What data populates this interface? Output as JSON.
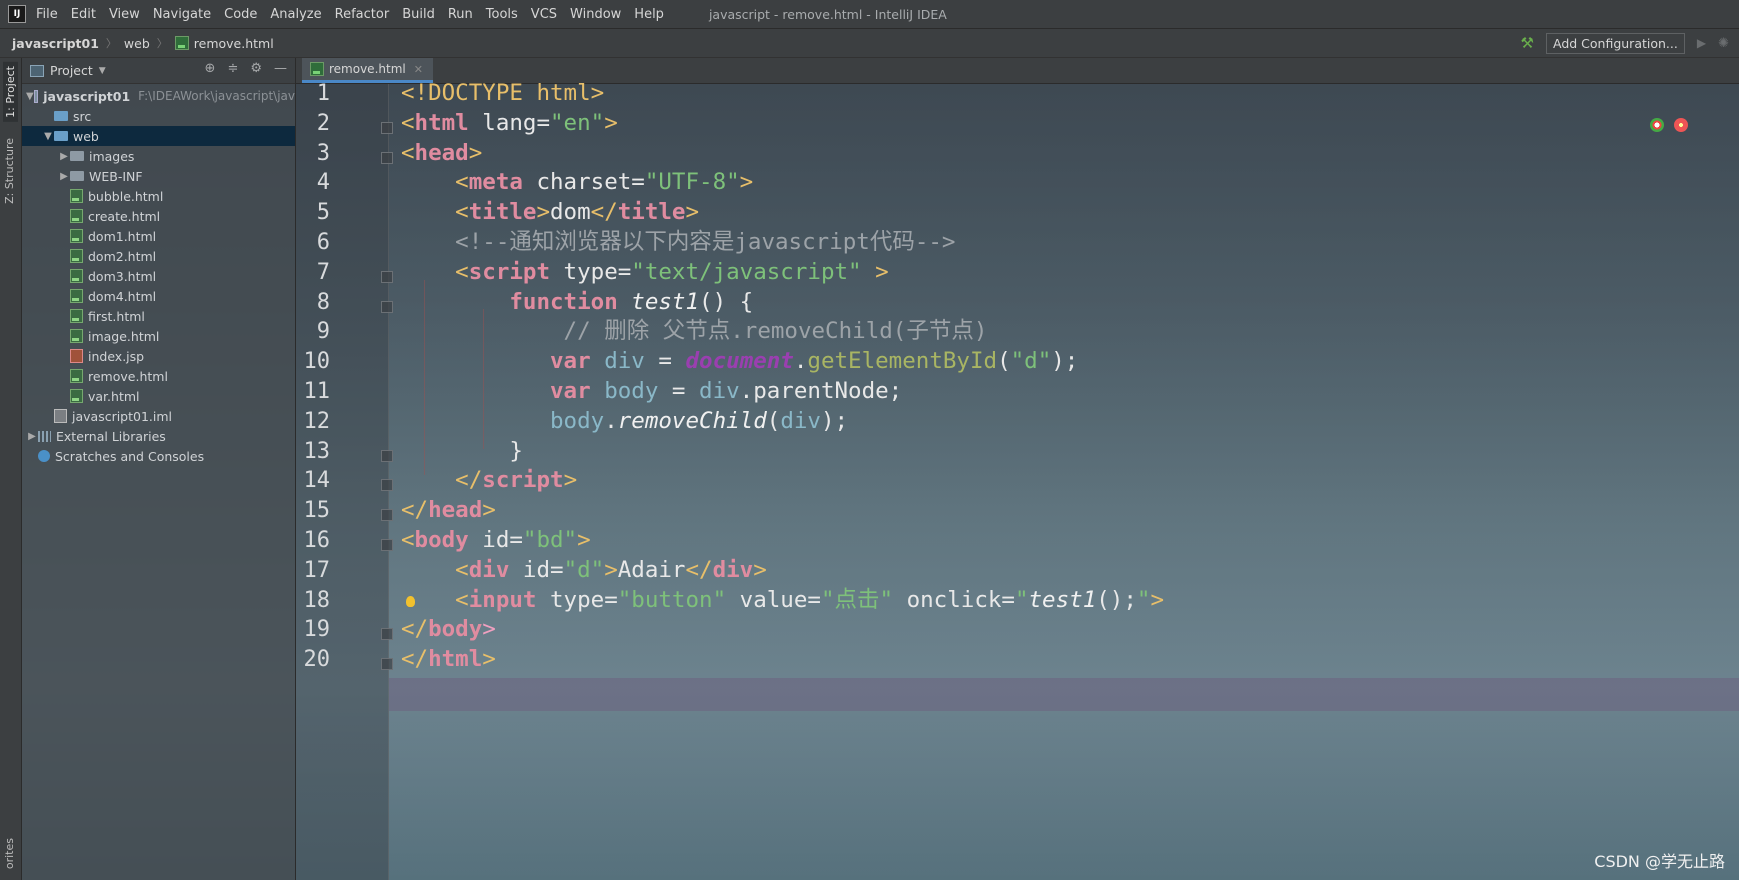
{
  "menubar": {
    "items": [
      "File",
      "Edit",
      "View",
      "Navigate",
      "Code",
      "Analyze",
      "Refactor",
      "Build",
      "Run",
      "Tools",
      "VCS",
      "Window",
      "Help"
    ],
    "window_title": "javascript - remove.html - IntelliJ IDEA"
  },
  "navbar": {
    "crumbs": [
      "javascript01",
      "web",
      "remove.html"
    ],
    "add_configuration": "Add Configuration..."
  },
  "left_strip": {
    "project_tab": "1: Project",
    "structure_tab": "Z: Structure",
    "favorites_tab": "orites"
  },
  "project_panel": {
    "title": "Project",
    "tree": [
      {
        "label": "javascript01",
        "path": "F:\\IDEAWork\\javascript\\jav",
        "type": "module",
        "indent": 0,
        "expanded": true
      },
      {
        "label": "src",
        "type": "folder-blue",
        "indent": 1
      },
      {
        "label": "web",
        "type": "folder-blue",
        "indent": 1,
        "expanded": true,
        "selected": true
      },
      {
        "label": "images",
        "type": "folder",
        "indent": 2,
        "collapsed": true
      },
      {
        "label": "WEB-INF",
        "type": "folder",
        "indent": 2,
        "collapsed": true
      },
      {
        "label": "bubble.html",
        "type": "html",
        "indent": 2
      },
      {
        "label": "create.html",
        "type": "html",
        "indent": 2
      },
      {
        "label": "dom1.html",
        "type": "html",
        "indent": 2
      },
      {
        "label": "dom2.html",
        "type": "html",
        "indent": 2
      },
      {
        "label": "dom3.html",
        "type": "html",
        "indent": 2
      },
      {
        "label": "dom4.html",
        "type": "html",
        "indent": 2
      },
      {
        "label": "first.html",
        "type": "html",
        "indent": 2
      },
      {
        "label": "image.html",
        "type": "html",
        "indent": 2
      },
      {
        "label": "index.jsp",
        "type": "jsp",
        "indent": 2
      },
      {
        "label": "remove.html",
        "type": "html",
        "indent": 2
      },
      {
        "label": "var.html",
        "type": "html",
        "indent": 2
      },
      {
        "label": "javascript01.iml",
        "type": "iml",
        "indent": 1
      },
      {
        "label": "External Libraries",
        "type": "lib",
        "indent": 0,
        "collapsed": true
      },
      {
        "label": "Scratches and Consoles",
        "type": "scratch",
        "indent": 0
      }
    ]
  },
  "editor": {
    "tab_label": "remove.html",
    "line_numbers": [
      "1",
      "2",
      "3",
      "4",
      "5",
      "6",
      "7",
      "8",
      "9",
      "10",
      "11",
      "12",
      "13",
      "14",
      "15",
      "16",
      "17",
      "18",
      "19",
      "20"
    ],
    "lines": [
      [
        [
          "tag",
          "<!DOCTYPE html>"
        ]
      ],
      [
        [
          "tag",
          "<"
        ],
        [
          "kw",
          "html"
        ],
        [
          "attr",
          " lang="
        ],
        [
          "str",
          "\"en\""
        ],
        [
          "tag",
          ">"
        ]
      ],
      [
        [
          "tag",
          "<"
        ],
        [
          "kw",
          "head"
        ],
        [
          "tag",
          ">"
        ]
      ],
      [
        [
          "tag",
          "    <"
        ],
        [
          "kw",
          "meta"
        ],
        [
          "attr",
          " charset="
        ],
        [
          "str",
          "\"UTF-8\""
        ],
        [
          "tag",
          ">"
        ]
      ],
      [
        [
          "tag",
          "    <"
        ],
        [
          "kw",
          "title"
        ],
        [
          "tag",
          ">"
        ],
        [
          "tagname",
          "dom"
        ],
        [
          "tag",
          "</"
        ],
        [
          "kw",
          "title"
        ],
        [
          "tag",
          ">"
        ]
      ],
      [
        [
          "cmt",
          "    <!--通知浏览器以下内容是javascript代码-->"
        ]
      ],
      [
        [
          "tag",
          "    <"
        ],
        [
          "kw",
          "script"
        ],
        [
          "attr",
          " type="
        ],
        [
          "str",
          "\"text/javascript\""
        ],
        [
          "attr",
          " "
        ],
        [
          "tag",
          ">"
        ]
      ],
      [
        [
          "kw",
          "        function"
        ],
        [
          "attr",
          " "
        ],
        [
          "fn",
          "test1"
        ],
        [
          "attr",
          "() {"
        ]
      ],
      [
        [
          "cmt",
          "            // 删除 父节点.removeChild(子节点)"
        ]
      ],
      [
        [
          "kw",
          "           var"
        ],
        [
          "ident",
          " div"
        ],
        [
          "attr",
          " = "
        ],
        [
          "docref",
          "document"
        ],
        [
          "attr",
          "."
        ],
        [
          "method",
          "getElementById"
        ],
        [
          "attr",
          "("
        ],
        [
          "str",
          "\"d\""
        ],
        [
          "attr",
          ");"
        ]
      ],
      [
        [
          "kw",
          "           var"
        ],
        [
          "ident",
          " body"
        ],
        [
          "attr",
          " = "
        ],
        [
          "ident",
          "div"
        ],
        [
          "attr",
          ".parentNode;"
        ]
      ],
      [
        [
          "ident",
          "           body"
        ],
        [
          "attr",
          "."
        ],
        [
          "fn",
          "removeChild"
        ],
        [
          "attr",
          "("
        ],
        [
          "ident",
          "div"
        ],
        [
          "attr",
          ");"
        ]
      ],
      [
        [
          "attr",
          "        }"
        ]
      ],
      [
        [
          "tag",
          "    </"
        ],
        [
          "kw",
          "script"
        ],
        [
          "tag",
          ">"
        ]
      ],
      [
        [
          "tag",
          "</"
        ],
        [
          "kw",
          "head"
        ],
        [
          "tag",
          ">"
        ]
      ],
      [
        [
          "tag",
          "<"
        ],
        [
          "kw",
          "body"
        ],
        [
          "attr",
          " id="
        ],
        [
          "str",
          "\"bd\""
        ],
        [
          "tag",
          ">"
        ]
      ],
      [
        [
          "tag",
          "    <"
        ],
        [
          "kw",
          "div"
        ],
        [
          "attr",
          " id="
        ],
        [
          "str",
          "\"d\""
        ],
        [
          "tag",
          ">"
        ],
        [
          "tagname",
          "Adair"
        ],
        [
          "tag",
          "</"
        ],
        [
          "kw",
          "div"
        ],
        [
          "tag",
          ">"
        ]
      ],
      [
        [
          "tag",
          "    <"
        ],
        [
          "kw",
          "input"
        ],
        [
          "attr",
          " type="
        ],
        [
          "str",
          "\"button\""
        ],
        [
          "attr",
          " value="
        ],
        [
          "str",
          "\"点击\""
        ],
        [
          "attr",
          " onclick="
        ],
        [
          "str",
          "\""
        ],
        [
          "fn",
          "test1"
        ],
        [
          "attr",
          "();"
        ],
        [
          "str",
          "\""
        ],
        [
          "tag",
          ">"
        ]
      ],
      [
        [
          "tag",
          "</"
        ],
        [
          "kw",
          "body"
        ],
        [
          "pink",
          ">"
        ]
      ],
      [
        [
          "tag",
          "</"
        ],
        [
          "kw",
          "html"
        ],
        [
          "tag",
          ">"
        ]
      ]
    ]
  },
  "watermark": "CSDN @学无止路",
  "colors": {
    "tag": "#e8bf6a",
    "keyword": "#e08ca0",
    "string": "#7ec17a",
    "comment": "#9da3a8"
  }
}
